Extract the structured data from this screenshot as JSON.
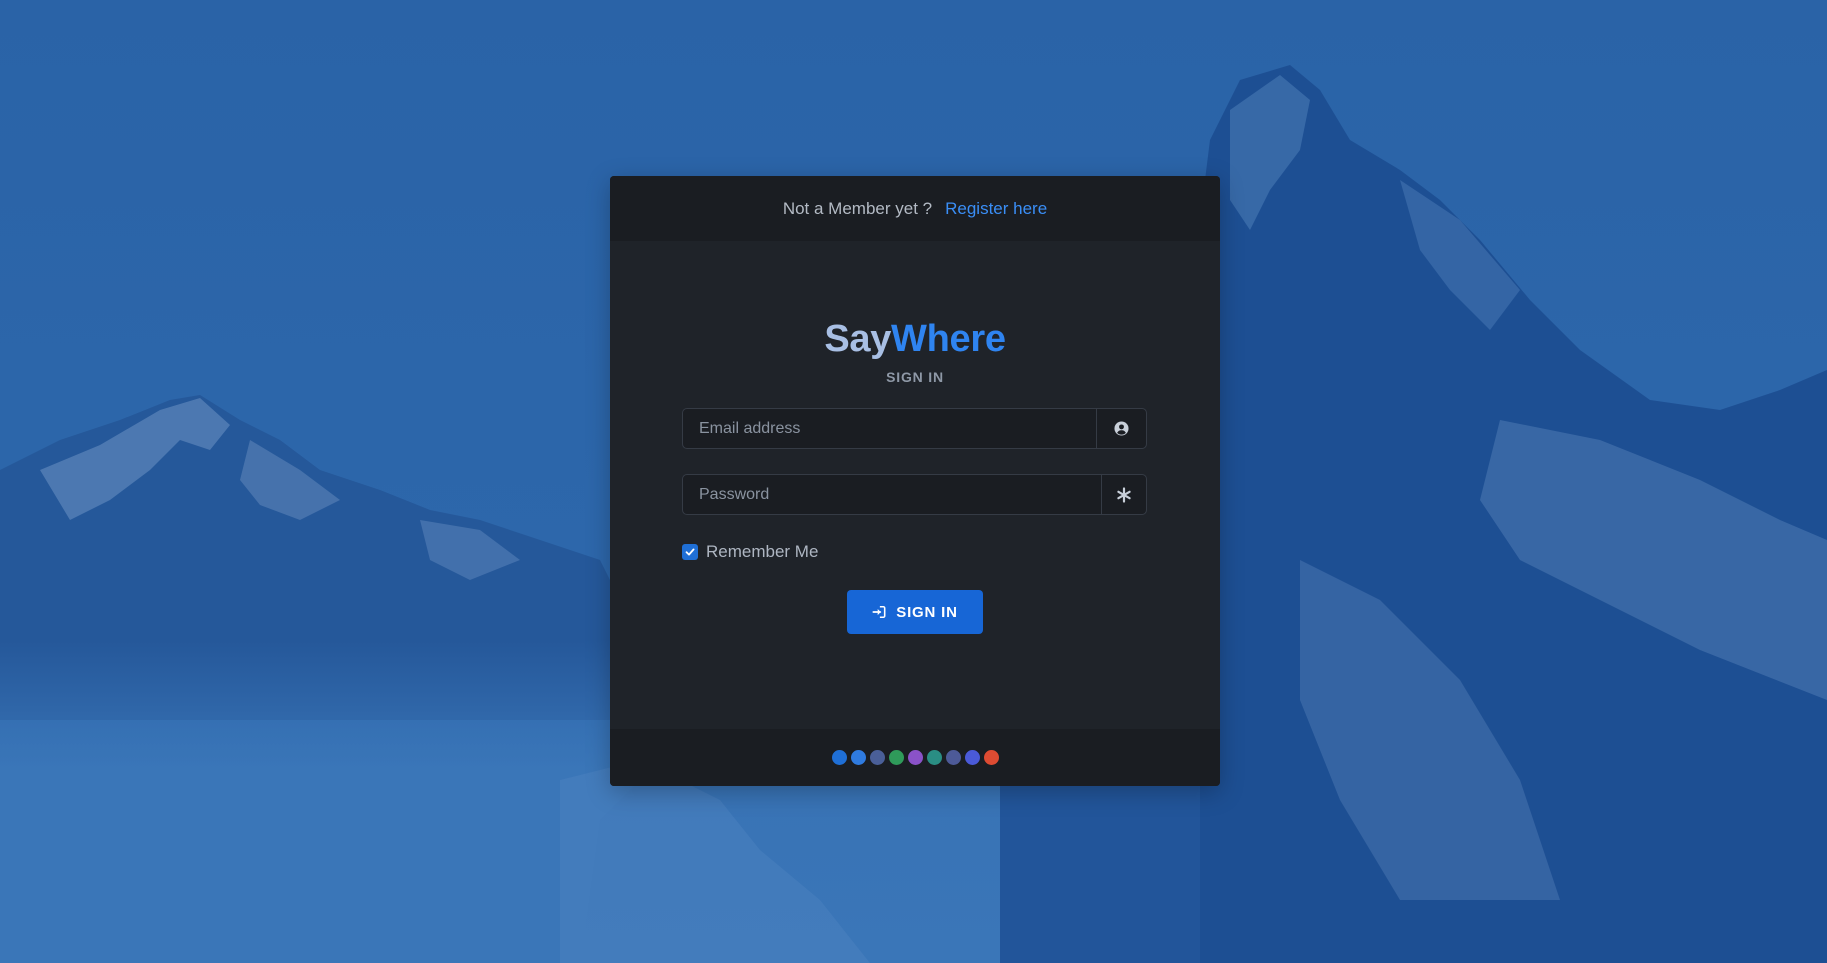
{
  "top_bar": {
    "prompt": "Not a Member yet ?",
    "register_link": "Register here"
  },
  "brand": {
    "part1": "Say",
    "part2": "Where"
  },
  "form": {
    "heading": "SIGN IN",
    "email_placeholder": "Email address",
    "password_placeholder": "Password",
    "remember_label": "Remember Me",
    "remember_checked": true,
    "submit_label": "SIGN IN",
    "email_icon": "user-circle-icon",
    "password_icon": "asterisk-icon",
    "submit_icon": "sign-in-icon"
  },
  "theme_swatches": [
    {
      "name": "blue",
      "color": "#1f6fd6"
    },
    {
      "name": "azure",
      "color": "#2f7be0"
    },
    {
      "name": "indigo-gray",
      "color": "#4a5f98"
    },
    {
      "name": "green",
      "color": "#2f9a5a"
    },
    {
      "name": "purple",
      "color": "#8a52c8"
    },
    {
      "name": "teal",
      "color": "#2a8e84"
    },
    {
      "name": "slate",
      "color": "#4d5a98"
    },
    {
      "name": "violet",
      "color": "#4a5ad8"
    },
    {
      "name": "red",
      "color": "#dd4b32"
    }
  ],
  "colors": {
    "background": "#2c65a6",
    "card": "#1f2329",
    "card_bars": "#1a1d22",
    "accent": "#2f84f0",
    "button": "#1766d6"
  }
}
